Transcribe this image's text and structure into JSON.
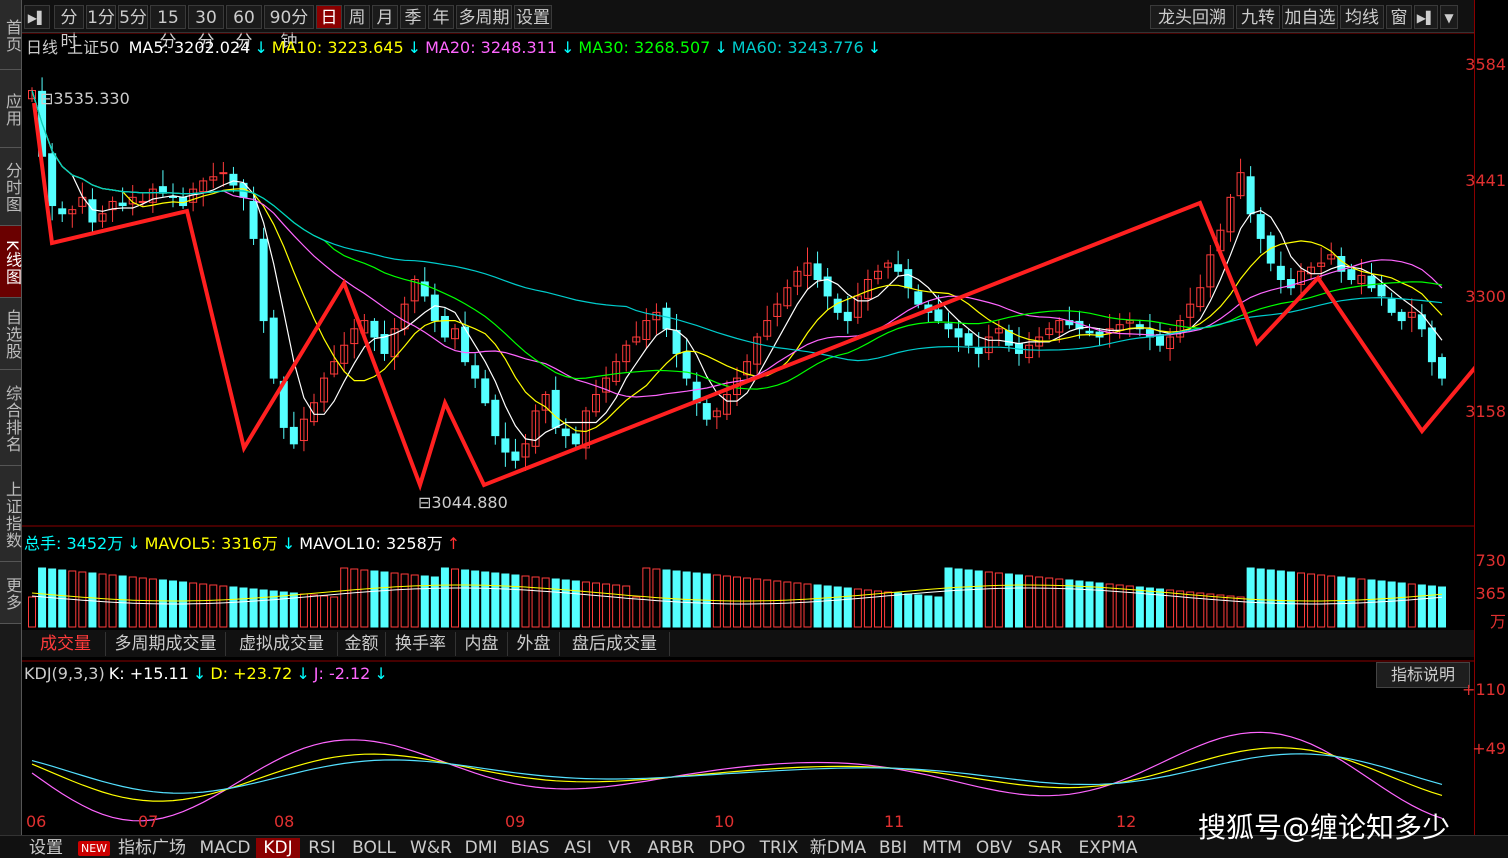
{
  "sidebar": {
    "tabs": [
      {
        "label": "首页"
      },
      {
        "label": "应用"
      },
      {
        "label": "分时图"
      },
      {
        "label": "K线图",
        "active": true
      },
      {
        "label": "自选股"
      },
      {
        "label": "综合排名"
      },
      {
        "label": "上证指数"
      },
      {
        "label": "更多"
      }
    ]
  },
  "topbar": {
    "left_icon": "playback-icon",
    "periods": [
      "分时",
      "1分",
      "5分",
      "15分",
      "30分",
      "60分",
      "90分钟",
      "日",
      "周",
      "月",
      "季",
      "年",
      "多周期",
      "设置"
    ],
    "active_period": "日",
    "right_items": [
      "龙头回溯",
      "九转",
      "加自选",
      "均线",
      "窗"
    ]
  },
  "chart_header": {
    "period": "日线",
    "symbol": "上证50",
    "ma": [
      {
        "label": "MA5: 3202.024",
        "arrow": "↓",
        "color": "#ffffff"
      },
      {
        "label": "MA10: 3223.645",
        "arrow": "↓",
        "color": "#ffff00"
      },
      {
        "label": "MA20: 3248.311",
        "arrow": "↓",
        "color": "#ff66ff"
      },
      {
        "label": "MA30: 3268.507",
        "arrow": "↓",
        "color": "#00ff00"
      },
      {
        "label": "MA60: 3243.776",
        "arrow": "↓",
        "color": "#00cccc"
      }
    ]
  },
  "price_labels": {
    "high": "3535.330",
    "low": "3044.880"
  },
  "y_axis": [
    "3584",
    "3441",
    "3300",
    "3158"
  ],
  "volume": {
    "legend": [
      {
        "label": "总手: 3452万",
        "arrow": "↓",
        "color": "#00ffff"
      },
      {
        "label": "MAVOL5: 3316万",
        "arrow": "↓",
        "color": "#ffff00"
      },
      {
        "label": "MAVOL10: 3258万",
        "arrow": "↑",
        "color": "#ffffff"
      }
    ],
    "y_axis": [
      "730",
      "365",
      "万"
    ]
  },
  "volume_tabs": [
    "成交量",
    "多周期成交量",
    "虚拟成交量",
    "金额",
    "换手率",
    "内盘",
    "外盘",
    "盘后成交量"
  ],
  "active_volume_tab": "成交量",
  "kdj": {
    "label": "KDJ(9,3,3)",
    "items": [
      {
        "label": "K: +15.11",
        "arrow": "↓",
        "color": "#ffffff"
      },
      {
        "label": "D: +23.72",
        "arrow": "↓",
        "color": "#ffff00"
      },
      {
        "label": "J: -2.12",
        "arrow": "↓",
        "color": "#ff66ff"
      }
    ],
    "y_axis": [
      "+110",
      "+49"
    ],
    "button": "指标说明"
  },
  "x_axis": [
    "06",
    "07",
    "08",
    "09",
    "10",
    "11",
    "12"
  ],
  "bottom_tabs": [
    "设置",
    "指标广场",
    "MACD",
    "KDJ",
    "RSI",
    "BOLL",
    "W&R",
    "DMI",
    "BIAS",
    "ASI",
    "VR",
    "ARBR",
    "DPO",
    "TRIX",
    "新DMA",
    "BBI",
    "MTM",
    "OBV",
    "SAR",
    "EXPMA"
  ],
  "active_bottom_tab": "KDJ",
  "new_badge": "NEW",
  "watermark": "搜狐号@缠论知多少",
  "chart_data": {
    "type": "candlestick",
    "close": [
      3530,
      3450,
      3390,
      3380,
      3385,
      3400,
      3370,
      3380,
      3395,
      3390,
      3400,
      3395,
      3410,
      3405,
      3400,
      3390,
      3410,
      3420,
      3425,
      3430,
      3415,
      3400,
      3350,
      3250,
      3180,
      3120,
      3100,
      3130,
      3150,
      3180,
      3200,
      3220,
      3240,
      3250,
      3230,
      3210,
      3240,
      3270,
      3300,
      3280,
      3250,
      3230,
      3240,
      3200,
      3180,
      3150,
      3110,
      3090,
      3080,
      3100,
      3140,
      3160,
      3120,
      3110,
      3100,
      3140,
      3160,
      3180,
      3200,
      3220,
      3230,
      3250,
      3260,
      3240,
      3210,
      3180,
      3150,
      3130,
      3140,
      3160,
      3180,
      3200,
      3230,
      3250,
      3270,
      3290,
      3310,
      3320,
      3300,
      3280,
      3260,
      3250,
      3280,
      3300,
      3310,
      3320,
      3310,
      3290,
      3270,
      3260,
      3250,
      3240,
      3230,
      3220,
      3210,
      3230,
      3240,
      3220,
      3210,
      3220,
      3230,
      3240,
      3250,
      3245,
      3240,
      3235,
      3230,
      3240,
      3245,
      3250,
      3240,
      3230,
      3220,
      3230,
      3250,
      3270,
      3290,
      3330,
      3360,
      3400,
      3430,
      3380,
      3350,
      3320,
      3300,
      3290,
      3310,
      3315,
      3320,
      3330,
      3310,
      3300,
      3305,
      3290,
      3280,
      3260,
      3250,
      3260,
      3240,
      3200,
      3180
    ]
  }
}
